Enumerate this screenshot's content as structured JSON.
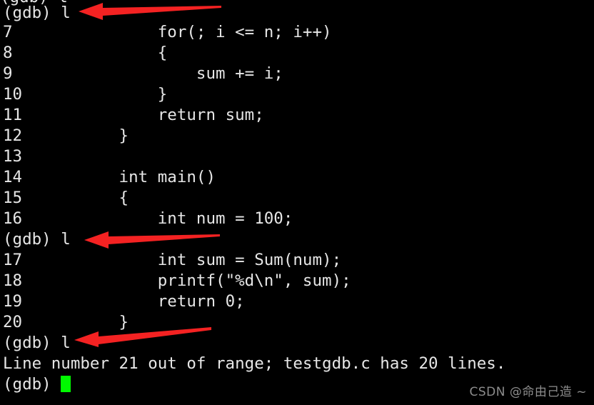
{
  "terminal": {
    "background_color": "#000000",
    "foreground_color": "#e6e6e6",
    "cursor_color": "#00f900",
    "clipped_top_line": "(gdb) l",
    "lines": [
      {
        "text": "(gdb) l"
      },
      {
        "text": "7\t        for(; i <= n; i++)"
      },
      {
        "text": "8\t        {"
      },
      {
        "text": "9\t            sum += i;"
      },
      {
        "text": "10\t        }"
      },
      {
        "text": "11\t        return sum;"
      },
      {
        "text": "12\t    }"
      },
      {
        "text": "13\t"
      },
      {
        "text": "14\t    int main()"
      },
      {
        "text": "15\t    {"
      },
      {
        "text": "16\t        int num = 100;"
      },
      {
        "text": "(gdb) l"
      },
      {
        "text": "17\t        int sum = Sum(num);"
      },
      {
        "text": "18\t        printf(\"%d\\n\", sum);"
      },
      {
        "text": "19\t        return 0;"
      },
      {
        "text": "20\t    }"
      },
      {
        "text": "(gdb) l"
      },
      {
        "text": "Line number 21 out of range; testgdb.c has 20 lines."
      },
      {
        "text": "(gdb) "
      }
    ],
    "prompt": "(gdb)",
    "command": "l",
    "error_message": "Line number 21 out of range; testgdb.c has 20 lines.",
    "source_file": "testgdb.c",
    "total_lines": "20",
    "requested_line": "21"
  },
  "annotations": {
    "color": "#f42222",
    "arrows": [
      {
        "label": "arrow-gdb-prompt-1"
      },
      {
        "label": "arrow-gdb-prompt-2"
      },
      {
        "label": "arrow-gdb-prompt-3"
      }
    ]
  },
  "watermark": {
    "text": "CSDN @命由己造 ~",
    "color": "#8d8d8d"
  }
}
